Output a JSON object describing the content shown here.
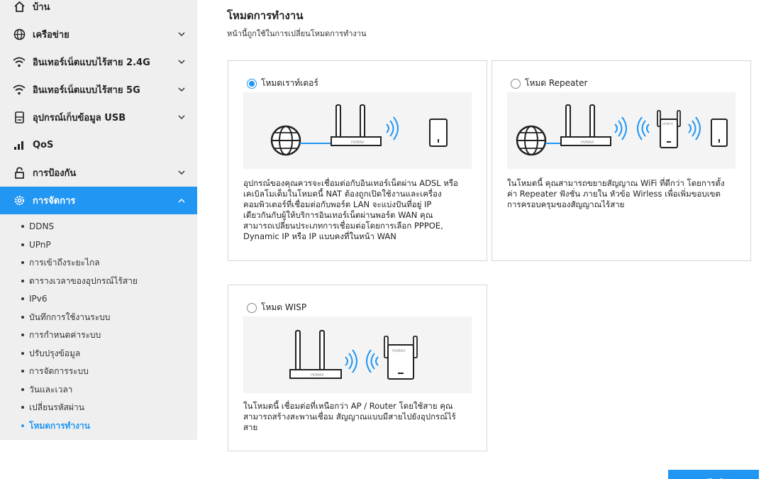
{
  "sidebar": {
    "items": [
      {
        "label": "บ้าน"
      },
      {
        "label": "เครือข่าย"
      },
      {
        "label": "อินเทอร์เน็ตแบบไร้สาย 2.4G"
      },
      {
        "label": "อินเทอร์เน็ตแบบไร้สาย 5G"
      },
      {
        "label": "อุปกรณ์เก็บข้อมูล USB"
      },
      {
        "label": "QoS"
      },
      {
        "label": "การป้องกัน"
      },
      {
        "label": "การจัดการ"
      }
    ],
    "sub_items": [
      {
        "label": "DDNS"
      },
      {
        "label": "UPnP"
      },
      {
        "label": "การเข้าถึงระยะไกล"
      },
      {
        "label": "ตารางเวลาของอุปกรณ์ไร้สาย"
      },
      {
        "label": "IPv6"
      },
      {
        "label": "บันทึกการใช้งานระบบ"
      },
      {
        "label": "การกำหนดค่าระบบ"
      },
      {
        "label": "ปรับปรุงข้อมูล"
      },
      {
        "label": "การจัดการระบบ"
      },
      {
        "label": "วันและเวลา"
      },
      {
        "label": "เปลี่ยนรหัสผ่าน"
      },
      {
        "label": "โหมดการทำงาน"
      }
    ]
  },
  "main": {
    "title": "โหมดการทำงาน",
    "description": "หน้านี้ถูกใช้ในการเปลี่ยนโหมดการทำงาน",
    "modes": [
      {
        "label": "โหมดเราท์เตอร์",
        "selected": true,
        "lines": [
          "อุปกรณ์ของคุณควรจะเชื่อมต่อกับอินเทอร์เน็ตผ่าน ADSL หรือ",
          "เคเบิลโมเด็มในโหมดนี้ NAT ต้องถูกเปิดใช้งานและเครื่อง",
          "คอมพิวเตอร์ที่เชื่อมต่อกับพอร์ต LAN จะแบ่งปันที่อยู่ IP",
          "เดียวกันกับผู้ให้บริการอินเทอร์เน็ตผ่านพอร์ต WAN คุณ",
          "สามารถเปลี่ยนประเภทการเชื่อมต่อโดยการเลือก PPPOE,",
          "Dynamic IP หรือ IP แบบคงที่ในหน้า WAN"
        ]
      },
      {
        "label": "โหมด Repeater",
        "selected": false,
        "lines": [
          "ในโหมดนี้ คุณสามารถขยายสัญญาณ WiFi ที่ดีกว่า โดยการตั้ง",
          "ค่า Repeater ฟังชั่น ภายใน หัวข้อ Wirless เพื่อเพิ่มขอบเขต",
          "การครอบครุมของสัญญาณไร้สาย"
        ]
      },
      {
        "label": "โหมด WISP",
        "selected": false,
        "lines": [
          "ในโหมดนี้ เชื่อมต่อที่เหนือกว่า AP / Router โดยใช้สาย คุณ",
          "สามารถสร้างสะพานเชื่อม สัญญาณแบบมีสายไปยังอุปกรณ์ไร้",
          "สาย"
        ]
      }
    ],
    "apply_label": "นำไปใช้"
  },
  "brand_text": "HUMAX",
  "colors": {
    "accent": "#2196f3",
    "sidebar_bg": "#efefef",
    "illustration_bg": "#f4f4f4"
  }
}
